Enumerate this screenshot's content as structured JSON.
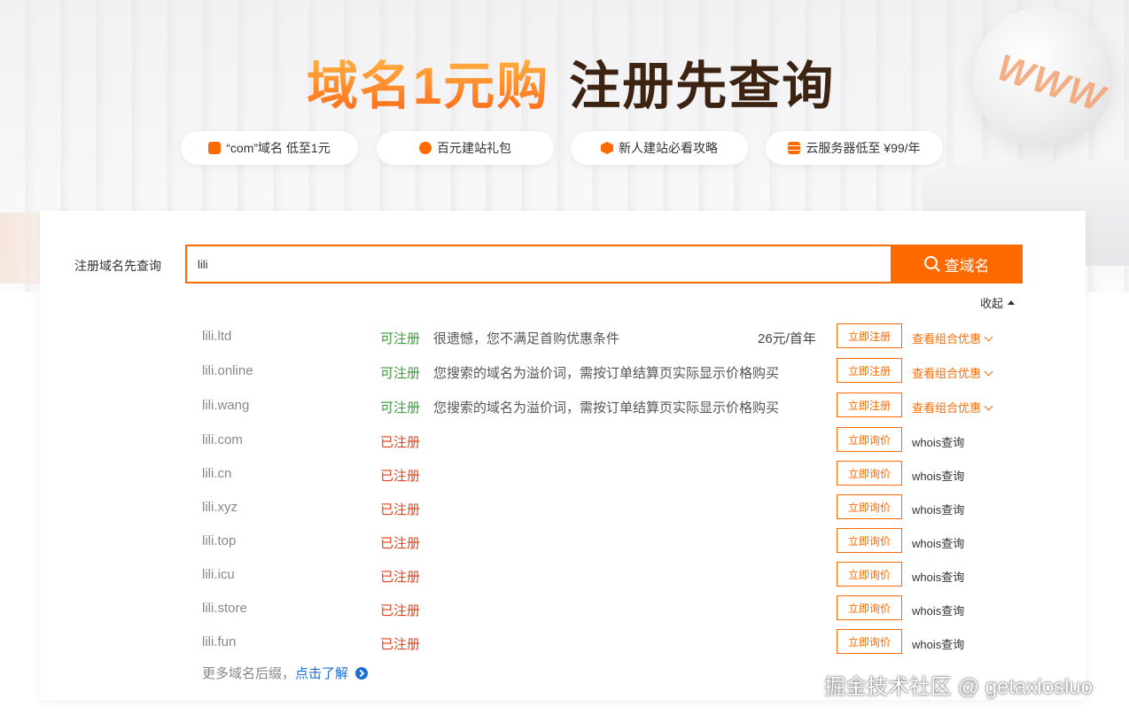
{
  "hero": {
    "title_orange": "域名1元购",
    "title_dark": "注册先查询",
    "globe_text": "WWW",
    "pills": [
      {
        "label": "“com”域名 低至1元",
        "icon": "domain-tag-icon"
      },
      {
        "label": "百元建站礼包",
        "icon": "globe-icon"
      },
      {
        "label": "新人建站必看攻略",
        "icon": "hexagon-icon"
      },
      {
        "label": "云服务器低至 ¥99/年",
        "icon": "server-icon"
      }
    ]
  },
  "search": {
    "label": "注册域名先查询",
    "value": "lili",
    "button_label": "查域名",
    "collapse_label": "收起"
  },
  "results": [
    {
      "domain": "lili.ltd",
      "status": "可注册",
      "message": "很遗憾，您不满足首购优惠条件",
      "price": "26元/首年",
      "action": "立即注册",
      "link": "查看组合优惠"
    },
    {
      "domain": "lili.online",
      "status": "可注册",
      "message": "您搜索的域名为溢价词，需按订单结算页实际显示价格购买",
      "price": "",
      "action": "立即注册",
      "link": "查看组合优惠"
    },
    {
      "domain": "lili.wang",
      "status": "可注册",
      "message": "您搜索的域名为溢价词，需按订单结算页实际显示价格购买",
      "price": "",
      "action": "立即注册",
      "link": "查看组合优惠"
    },
    {
      "domain": "lili.com",
      "status": "已注册",
      "message": "",
      "price": "",
      "action": "立即询价",
      "link": "whois查询"
    },
    {
      "domain": "lili.cn",
      "status": "已注册",
      "message": "",
      "price": "",
      "action": "立即询价",
      "link": "whois查询"
    },
    {
      "domain": "lili.xyz",
      "status": "已注册",
      "message": "",
      "price": "",
      "action": "立即询价",
      "link": "whois查询"
    },
    {
      "domain": "lili.top",
      "status": "已注册",
      "message": "",
      "price": "",
      "action": "立即询价",
      "link": "whois查询"
    },
    {
      "domain": "lili.icu",
      "status": "已注册",
      "message": "",
      "price": "",
      "action": "立即询价",
      "link": "whois查询"
    },
    {
      "domain": "lili.store",
      "status": "已注册",
      "message": "",
      "price": "",
      "action": "立即询价",
      "link": "whois查询"
    },
    {
      "domain": "lili.fun",
      "status": "已注册",
      "message": "",
      "price": "",
      "action": "立即询价",
      "link": "whois查询"
    }
  ],
  "more": {
    "text": "更多域名后缀，",
    "link": "点击了解"
  },
  "watermark": "掘金技术社区 @ getaxiosluo",
  "colors": {
    "accent": "#ff6a00",
    "available": "#3a9c3a",
    "registered": "#e0421b",
    "link_blue": "#1a6fd6"
  }
}
